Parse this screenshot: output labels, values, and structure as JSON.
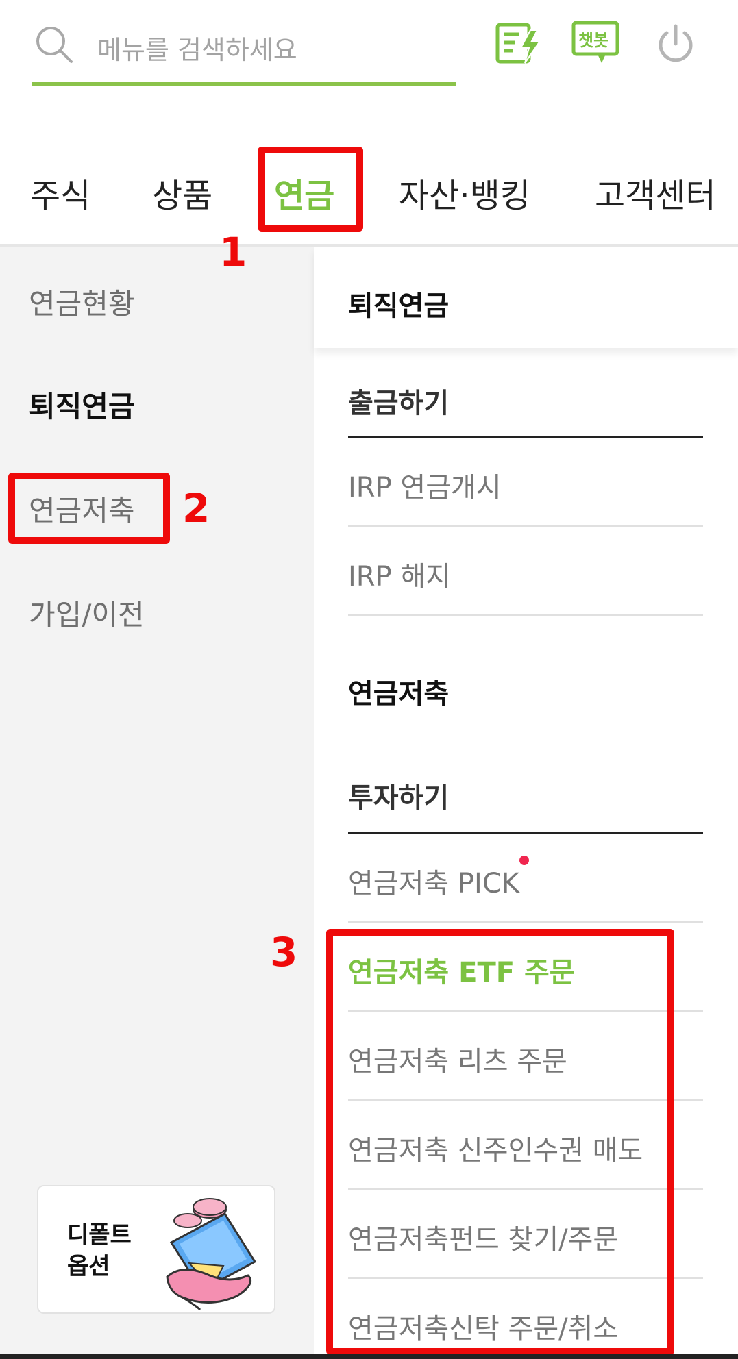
{
  "search": {
    "placeholder": "메뉴를 검색하세요"
  },
  "top_icons": {
    "chatbot_label": "챗봇",
    "accent_color": "#7cc242"
  },
  "main_tabs": [
    {
      "label": "주식"
    },
    {
      "label": "상품"
    },
    {
      "label": "연금",
      "active": true
    },
    {
      "label": "자산·뱅킹"
    },
    {
      "label": "고객센터"
    }
  ],
  "side_menu": {
    "items": [
      {
        "label": "연금현황"
      },
      {
        "label": "퇴직연금",
        "bold": true
      },
      {
        "label": "연금저축"
      },
      {
        "label": "가입/이전"
      }
    ],
    "promo_card": {
      "title": "디폴트\n옵션"
    }
  },
  "content": {
    "retirement": {
      "title": "퇴직연금",
      "withdraw_group": {
        "title": "출금하기",
        "items": [
          "IRP 연금개시",
          "IRP 해지"
        ]
      }
    },
    "savings": {
      "title": "연금저축",
      "invest_group": {
        "title": "투자하기",
        "items": [
          {
            "label": "연금저축 PICK",
            "new_badge": true
          },
          {
            "label": "연금저축 ETF 주문",
            "active": true
          },
          {
            "label": "연금저축 리츠 주문"
          },
          {
            "label": "연금저축 신주인수권 매도"
          },
          {
            "label": "연금저축펀드 찾기/주문"
          },
          {
            "label": "연금저축신탁 주문/취소"
          }
        ]
      }
    }
  },
  "annotations": {
    "n1": "1",
    "n2": "2",
    "n3": "3",
    "color": "#ee0a0a"
  }
}
